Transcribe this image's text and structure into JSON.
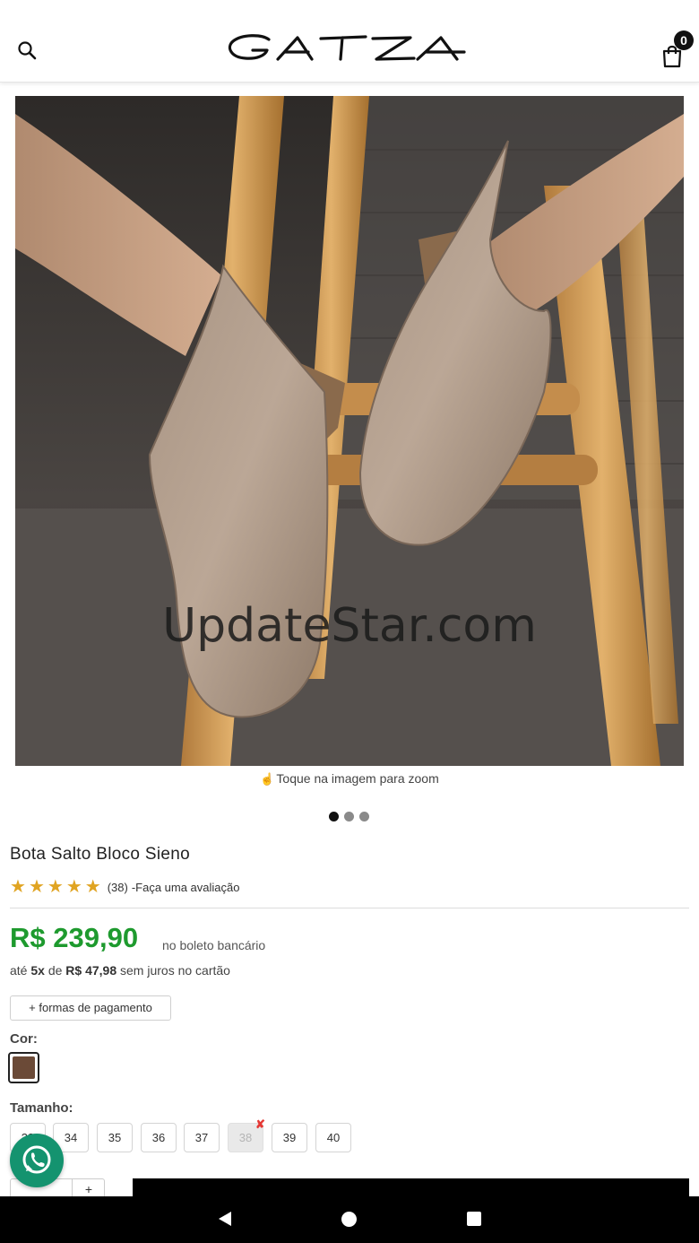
{
  "header": {
    "brand": "GATZA",
    "cart_count": "0",
    "search_icon": "search-icon",
    "cart_icon": "shopping-bag-icon"
  },
  "gallery": {
    "watermark": "UpdateStar.com",
    "zoom_hint": "Toque na imagem para zoom",
    "zoom_icon": "tap-hand-icon",
    "slide_count": 3,
    "active_slide": 1
  },
  "product": {
    "title": "Bota Salto Bloco Sieno",
    "rating_stars": 5,
    "rating_count": "(38)",
    "review_link": "-Faça uma avaliação",
    "price": "R$ 239,90",
    "price_note": "no boleto bancário",
    "installments": {
      "prefix": "até",
      "count": "5x",
      "middle": "de",
      "amount": "R$ 47,98",
      "suffix": "sem juros no cartão"
    },
    "payment_button": "+ formas de pagamento",
    "color_label": "Cor:",
    "colors": [
      {
        "name": "Sieno",
        "hex": "#6b4a37",
        "selected": true
      }
    ],
    "size_label": "Tamanho:",
    "sizes": [
      {
        "label": "33",
        "available": true
      },
      {
        "label": "34",
        "available": true
      },
      {
        "label": "35",
        "available": true
      },
      {
        "label": "36",
        "available": true
      },
      {
        "label": "37",
        "available": true
      },
      {
        "label": "38",
        "available": false
      },
      {
        "label": "39",
        "available": true
      },
      {
        "label": "40",
        "available": true
      }
    ],
    "unavailable_mark": "✘",
    "qty_plus": "+"
  },
  "colors": {
    "price_green": "#1e9a2e",
    "whatsapp_green": "#14936f",
    "star_gold": "#e0a422"
  }
}
